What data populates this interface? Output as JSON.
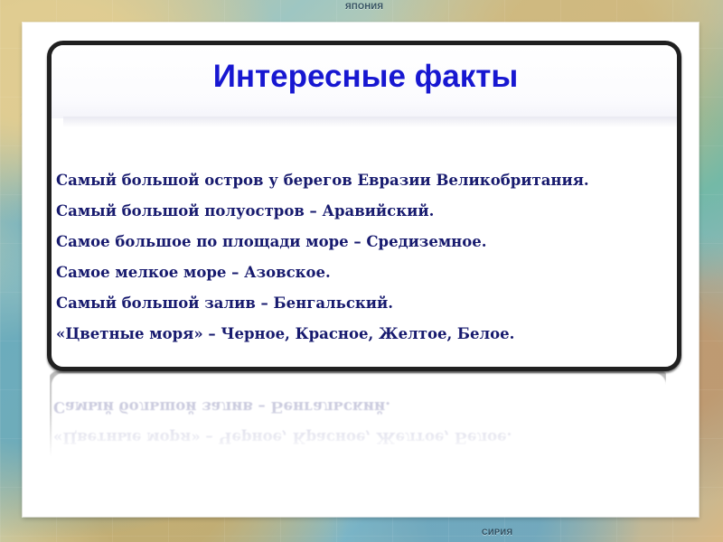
{
  "background": {
    "map_labels": {
      "top": "ЯПОНИЯ",
      "bottom": "СИРИЯ"
    },
    "colors": {
      "sea": "#7db7c8",
      "land": "#d7c18b",
      "panel": "#ffffff",
      "frame": "#202020",
      "title": "#1717d1",
      "fact_text": "#171a6e"
    }
  },
  "slide": {
    "title": "Интересные факты",
    "facts": [
      "Самый большой остров у берегов Евразии Великобритания.",
      "Самый большой полуостров – Аравийский.",
      "Самое большое по площади море – Средиземное.",
      "Самое мелкое море – Азовское.",
      "Самый большой залив – Бенгальский.",
      "«Цветные моря» – Черное, Красное, Желтое, Белое."
    ]
  }
}
